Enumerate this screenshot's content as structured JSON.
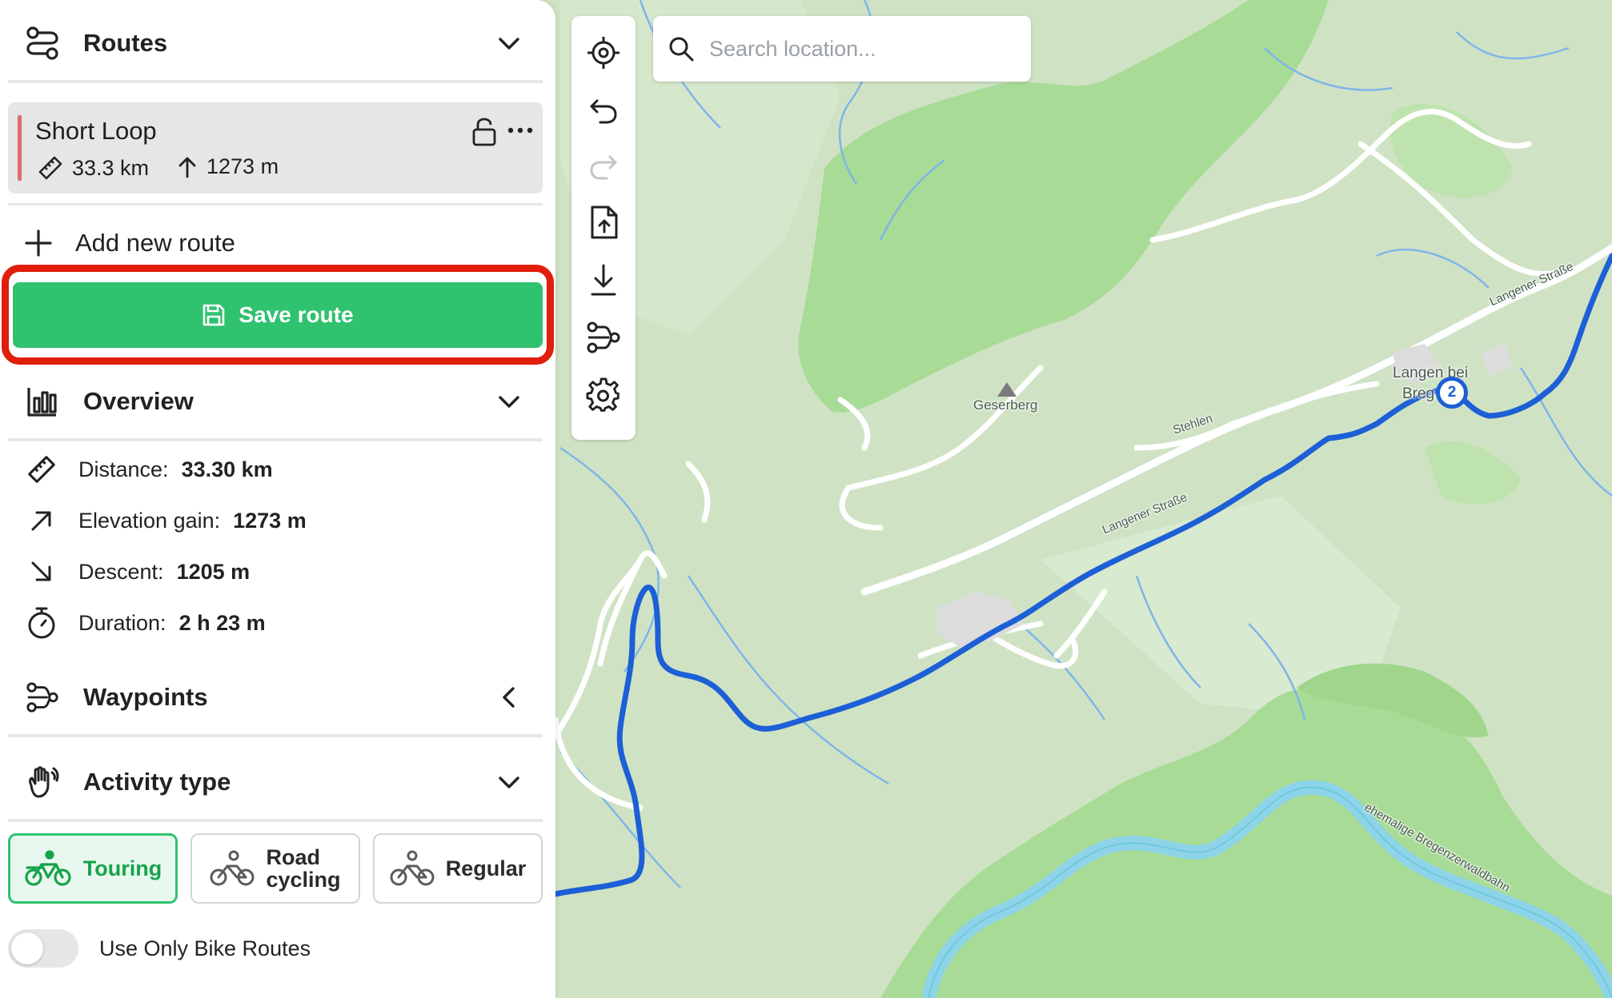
{
  "routes_section": {
    "title": "Routes"
  },
  "route_card": {
    "name": "Short Loop",
    "distance": "33.3 km",
    "elevation": "1273 m"
  },
  "add_route_label": "Add new route",
  "save_route_label": "Save route",
  "overview": {
    "title": "Overview",
    "rows": [
      {
        "label": "Distance:",
        "value": "33.30 km",
        "icon": "ruler-icon"
      },
      {
        "label": "Elevation gain:",
        "value": "1273 m",
        "icon": "arrow-up-right-icon"
      },
      {
        "label": "Descent:",
        "value": "1205 m",
        "icon": "arrow-down-right-icon"
      },
      {
        "label": "Duration:",
        "value": "2 h 23 m",
        "icon": "stopwatch-icon"
      }
    ]
  },
  "waypoints": {
    "title": "Waypoints"
  },
  "activity": {
    "title": "Activity type",
    "options": [
      {
        "label": "Touring",
        "active": true
      },
      {
        "label": "Road cycling",
        "line1": "Road",
        "line2": "cycling",
        "active": false
      },
      {
        "label": "Regular",
        "active": false
      }
    ]
  },
  "bike_routes_toggle": {
    "label": "Use Only Bike Routes",
    "on": false
  },
  "search": {
    "placeholder": "Search location..."
  },
  "toolbar": {
    "buttons": [
      "locate-icon",
      "undo-icon",
      "redo-icon",
      "upload-file-icon",
      "download-icon",
      "waypoints-icon",
      "settings-icon"
    ]
  },
  "map": {
    "labels": {
      "peak": "Geserberg",
      "street1": "Langener Straße",
      "street2": "Langener Straße",
      "stehlen": "Stehlen",
      "town_line1": "Langen bei",
      "town_line2": "Breg",
      "railway": "ehemalige Bregenzerwaldbahn"
    },
    "waypoint_number": "2",
    "route_color": "#1d5fd6",
    "forest_color": "#a8db96",
    "water_color": "#8ed4e8"
  },
  "colors": {
    "accent_green": "#2fc26f",
    "highlight_red": "#e01e0b",
    "route_red": "#e06b6b"
  }
}
